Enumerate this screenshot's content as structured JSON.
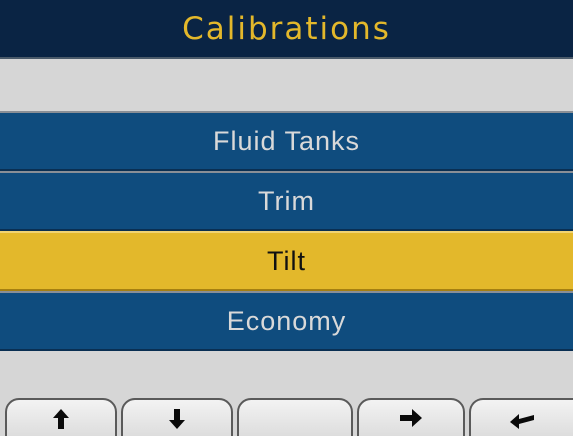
{
  "title": "Calibrations",
  "menu": {
    "items": [
      {
        "label": "Fluid Tanks",
        "selected": false
      },
      {
        "label": "Trim",
        "selected": false
      },
      {
        "label": "Tilt",
        "selected": true
      },
      {
        "label": "Economy",
        "selected": false
      }
    ]
  },
  "softkeys": [
    {
      "icon": "arrow-up-icon"
    },
    {
      "icon": "arrow-down-icon"
    },
    {
      "icon": ""
    },
    {
      "icon": "arrow-right-icon"
    },
    {
      "icon": "enter-arrow-icon"
    }
  ],
  "colors": {
    "header_bg": "#0a2444",
    "header_text": "#e3b82b",
    "menu_bg": "#0f4c7e",
    "menu_text": "#d9d9d9",
    "selected_bg": "#e3b82b",
    "selected_text": "#111111",
    "background": "#d6d6d6"
  }
}
